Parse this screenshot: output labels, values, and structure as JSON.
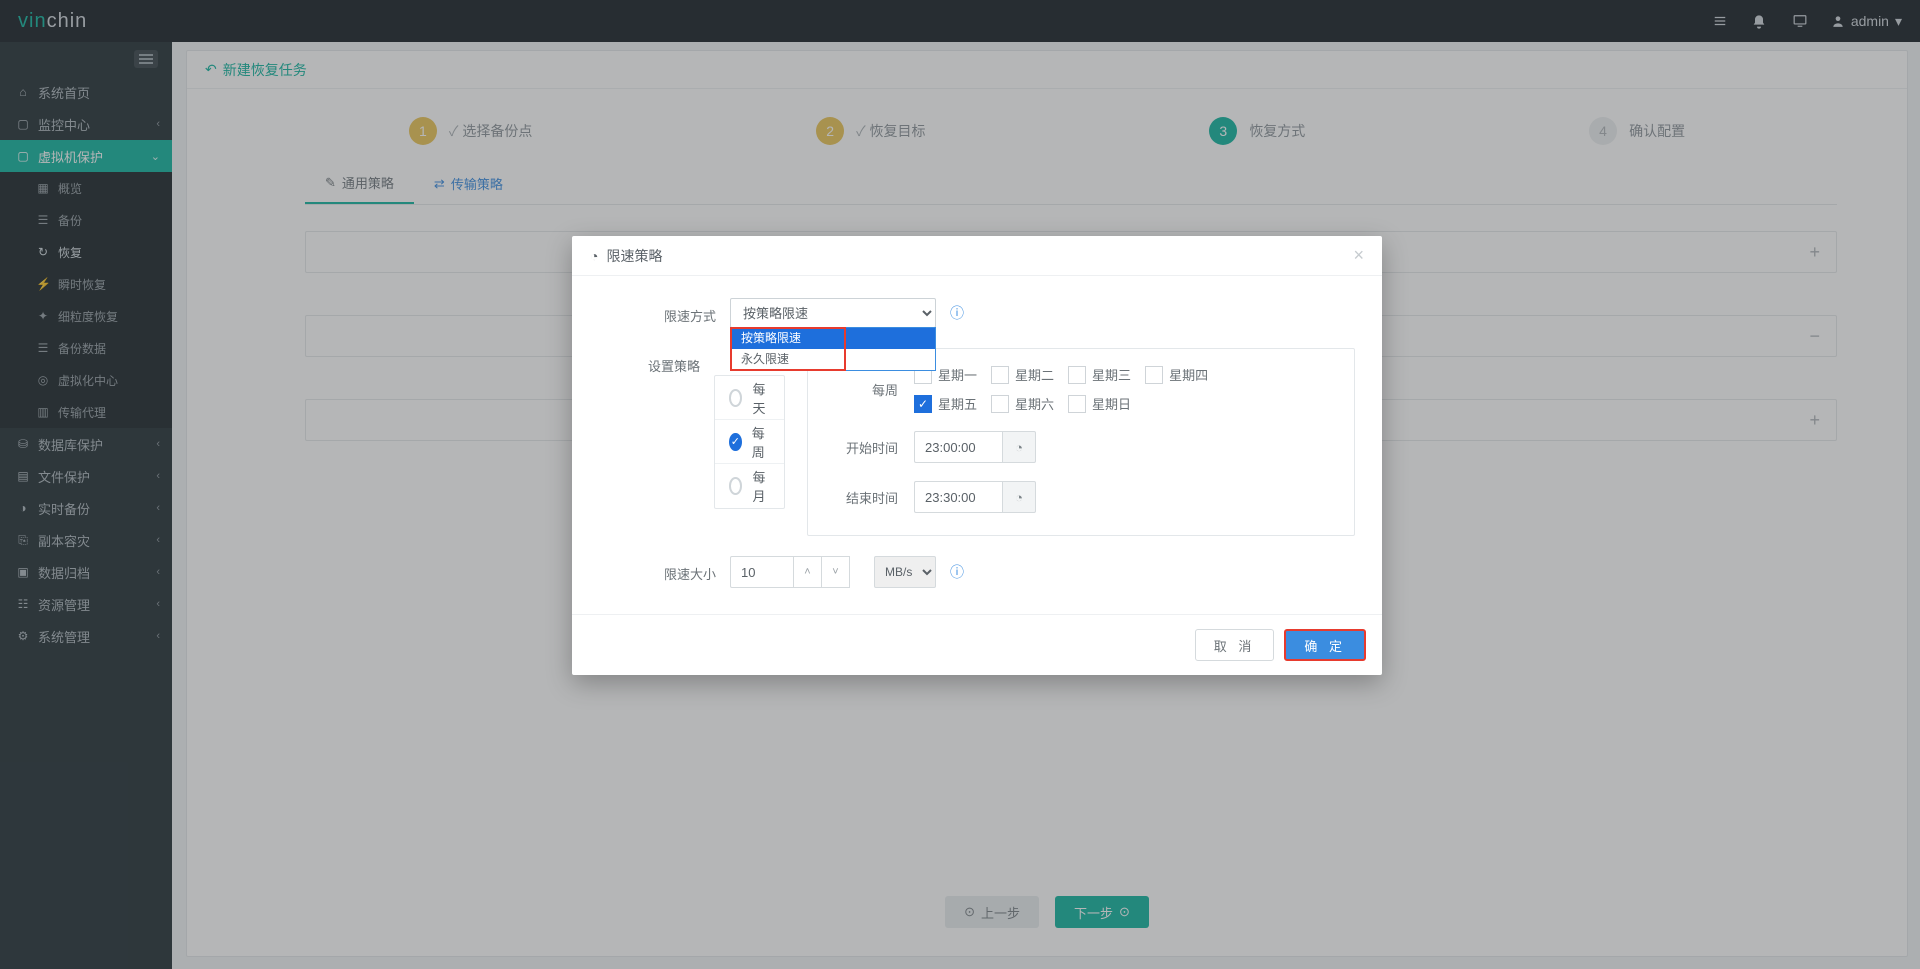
{
  "brand": {
    "part1": "vin",
    "part2": "chin"
  },
  "topbar": {
    "user": "admin"
  },
  "sidebar": {
    "items": [
      {
        "label": "系统首页"
      },
      {
        "label": "监控中心"
      },
      {
        "label": "虚拟机保护"
      },
      {
        "label": "数据库保护"
      },
      {
        "label": "文件保护"
      },
      {
        "label": "实时备份"
      },
      {
        "label": "副本容灾"
      },
      {
        "label": "数据归档"
      },
      {
        "label": "资源管理"
      },
      {
        "label": "系统管理"
      }
    ],
    "vm_sub": [
      {
        "label": "概览"
      },
      {
        "label": "备份"
      },
      {
        "label": "恢复"
      },
      {
        "label": "瞬时恢复"
      },
      {
        "label": "细粒度恢复"
      },
      {
        "label": "备份数据"
      },
      {
        "label": "虚拟化中心"
      },
      {
        "label": "传输代理"
      }
    ]
  },
  "page": {
    "title": "新建恢复任务",
    "steps": [
      {
        "num": "1",
        "label": "选择备份点"
      },
      {
        "num": "2",
        "label": "恢复目标"
      },
      {
        "num": "3",
        "label": "恢复方式"
      },
      {
        "num": "4",
        "label": "确认配置"
      }
    ],
    "tabs": {
      "general": "通用策略",
      "transfer": "传输策略"
    },
    "footer": {
      "prev": "上一步",
      "next": "下一步"
    }
  },
  "modal": {
    "title": "限速策略",
    "fields": {
      "mode_label": "限速方式",
      "mode_value": "按策略限速",
      "mode_options": [
        "按策略限速",
        "永久限速"
      ],
      "policy_label": "设置策略",
      "periods": {
        "daily": "每天",
        "weekly": "每周",
        "monthly": "每月"
      },
      "weekly_label": "每周",
      "days": [
        "星期一",
        "星期二",
        "星期三",
        "星期四",
        "星期五",
        "星期六",
        "星期日"
      ],
      "checked_day_index": 4,
      "start_label": "开始时间",
      "start_value": "23:00:00",
      "end_label": "结束时间",
      "end_value": "23:30:00",
      "speed_label": "限速大小",
      "speed_value": "10",
      "unit_value": "MB/s"
    },
    "buttons": {
      "cancel": "取 消",
      "ok": "确 定"
    }
  }
}
